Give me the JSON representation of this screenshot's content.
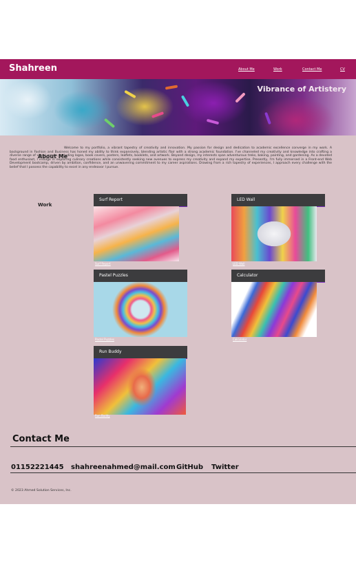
{
  "navbar": {
    "brand": "Shahreen",
    "links": [
      "About Me",
      "Work",
      "Contact Me",
      "CV"
    ],
    "bg_color": "#a3175c"
  },
  "hero": {
    "title": "Vibrance of Artistery"
  },
  "about": {
    "heading": "About Me",
    "text": "Welcome to my portfolio, a vibrant tapestry of creativity and innovation. My passion for design and dedication to academic excellence converge in my work. A background in Fashion and Business has honed my ability to think expansively, blending artistic flair with a strong academic foundation. I've channeled my creativity and knowledge into crafting a diverse range of visual assets, including logos, book covers, posters, leaflets, booklets, and artwork. Beyond design, my interests span adventurous treks, baking, painting, and gardening. As a devoted food enthusiast, I indulge in exploring culinary creations while consistently seeking new avenues to express my creativity and expand my expertise. Presently, I'm fully immersed in a Front-end Web Development bootcamp, driven by ambition, confidence, and an unwavering commitment to my career aspirations. Drawing from a rich tapestry of experiences, I approach every challenge with the belief that I possess the capability to excel in any endeavor I pursue."
  },
  "work": {
    "heading": "Work",
    "projects": [
      {
        "title": "Surf Report",
        "caption": "Surf Report",
        "icon": "surf-report-image"
      },
      {
        "title": "LED Wall",
        "caption": "LED Wall",
        "icon": "led-wall-image"
      },
      {
        "title": "Pastel Puzzles",
        "caption": "Pastel Puzzles",
        "icon": "pastel-puzzles-image"
      },
      {
        "title": "Calculator",
        "caption": "Calculator",
        "icon": "calculator-image"
      },
      {
        "title": "Run Buddy",
        "caption": "Run Buddy",
        "icon": "run-buddy-image"
      }
    ]
  },
  "contact": {
    "heading": "Contact Me",
    "phone": "01152221445",
    "email": "shahreenahmed@mail.com",
    "github": "GitHub",
    "twitter": "Twitter"
  },
  "footer": {
    "text": "© 2023 Ahmed Solution Services, Inc."
  },
  "colors": {
    "page_bg": "#d9c3c8",
    "card_header": "#3c3c3e",
    "card_accent": "#7b2fc0"
  }
}
